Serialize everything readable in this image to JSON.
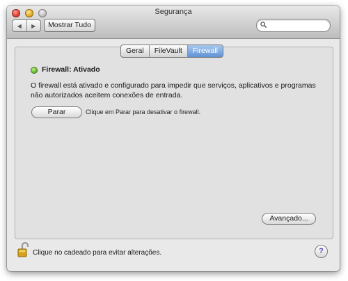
{
  "window": {
    "title": "Segurança"
  },
  "toolbar": {
    "back_icon": "back-arrow-icon",
    "forward_icon": "forward-arrow-icon",
    "show_all_label": "Mostrar Tudo",
    "search_icon": "search-icon",
    "search_value": ""
  },
  "tabs": [
    {
      "label": "Geral",
      "active": false
    },
    {
      "label": "FileVault",
      "active": false
    },
    {
      "label": "Firewall",
      "active": true
    }
  ],
  "firewall": {
    "status_color": "#57b21d",
    "status_label": "Firewall: Ativado",
    "description": "O firewall está ativado e configurado para impedir que serviços, aplicativos e programas não autorizados aceitem conexões de entrada.",
    "stop_button_label": "Parar",
    "stop_hint": "Clique em Parar para desativar o firewall.",
    "advanced_button_label": "Avançado..."
  },
  "footer": {
    "lock_icon": "unlocked-padlock-icon",
    "lock_text": "Clique no cadeado para evitar alterações.",
    "help_label": "?"
  }
}
